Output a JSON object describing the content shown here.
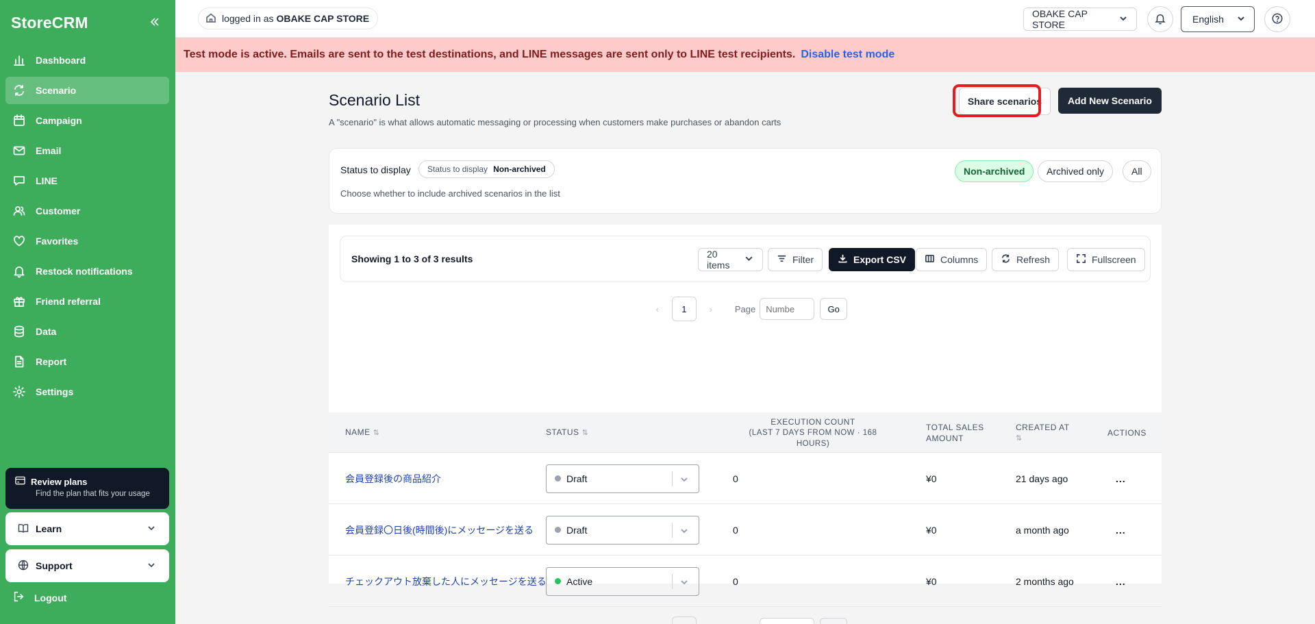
{
  "app": {
    "brand": "StoreCRM"
  },
  "sidebar": {
    "items": [
      {
        "label": "Dashboard",
        "icon": "bar-chart-icon",
        "active": false
      },
      {
        "label": "Scenario",
        "icon": "refresh-cycle-icon",
        "active": true
      },
      {
        "label": "Campaign",
        "icon": "calendar-icon",
        "active": false
      },
      {
        "label": "Email",
        "icon": "mail-icon",
        "active": false
      },
      {
        "label": "LINE",
        "icon": "chat-bubble-icon",
        "active": false
      },
      {
        "label": "Customer",
        "icon": "users-icon",
        "active": false
      },
      {
        "label": "Favorites",
        "icon": "heart-icon",
        "active": false
      },
      {
        "label": "Restock notifications",
        "icon": "bell-icon",
        "active": false
      },
      {
        "label": "Friend referral",
        "icon": "gift-icon",
        "active": false
      },
      {
        "label": "Data",
        "icon": "database-icon",
        "active": false
      },
      {
        "label": "Report",
        "icon": "document-icon",
        "active": false
      },
      {
        "label": "Settings",
        "icon": "gear-icon",
        "active": false
      }
    ],
    "review": {
      "title": "Review plans",
      "subtitle": "Find the plan that fits your usage"
    },
    "learn": "Learn",
    "support": "Support",
    "logout": "Logout"
  },
  "topbar": {
    "login_prefix": "logged in as",
    "login_store": "OBAKE CAP STORE",
    "store_select": "OBAKE CAP STORE",
    "language": "English"
  },
  "banner": {
    "text": "Test mode is active. Emails are sent to the test destinations, and LINE messages are sent only to LINE test recipients.",
    "link": "Disable test mode"
  },
  "page": {
    "title": "Scenario List",
    "description": "A \"scenario\" is what allows automatic messaging or processing when customers make purchases or abandon carts",
    "share_button": "Share scenarios",
    "add_button": "Add New Scenario"
  },
  "status_filter": {
    "label": "Status to display",
    "chip_key": "Status to display",
    "chip_value": "Non-archived",
    "hint": "Choose whether to include archived scenarios in the list",
    "options": [
      "Non-archived",
      "Archived only",
      "All"
    ],
    "selected": "Non-archived"
  },
  "toolbar": {
    "count": "Showing 1 to 3 of 3 results",
    "page_size": "20 items",
    "filter": "Filter",
    "export": "Export CSV",
    "columns": "Columns",
    "refresh": "Refresh",
    "fullscreen": "Fullscreen"
  },
  "pager": {
    "current_page": "1",
    "page_label": "Page",
    "input_placeholder": "Numbe",
    "go": "Go"
  },
  "table": {
    "headers": {
      "name": "NAME",
      "status": "STATUS",
      "exec_count": "EXECUTION COUNT",
      "exec_sub": "(LAST 7 DAYS FROM NOW · 168 HOURS)",
      "sales_1": "TOTAL SALES",
      "sales_2": "AMOUNT",
      "created": "CREATED AT",
      "actions": "ACTIONS"
    },
    "rows": [
      {
        "name": "会員登録後の商品紹介",
        "status": "Draft",
        "status_color": "#9ca3af",
        "exec_count": "0",
        "sales": "¥0",
        "created": "21 days ago",
        "actions": "..."
      },
      {
        "name": "会員登録〇日後(時間後)にメッセージを送る",
        "status": "Draft",
        "status_color": "#9ca3af",
        "exec_count": "0",
        "sales": "¥0",
        "created": "a month ago",
        "actions": "..."
      },
      {
        "name": "チェックアウト放棄した人にメッセージを送る",
        "status": "Active",
        "status_color": "#22c55e",
        "exec_count": "0",
        "sales": "¥0",
        "created": "2 months ago",
        "actions": "..."
      }
    ]
  }
}
